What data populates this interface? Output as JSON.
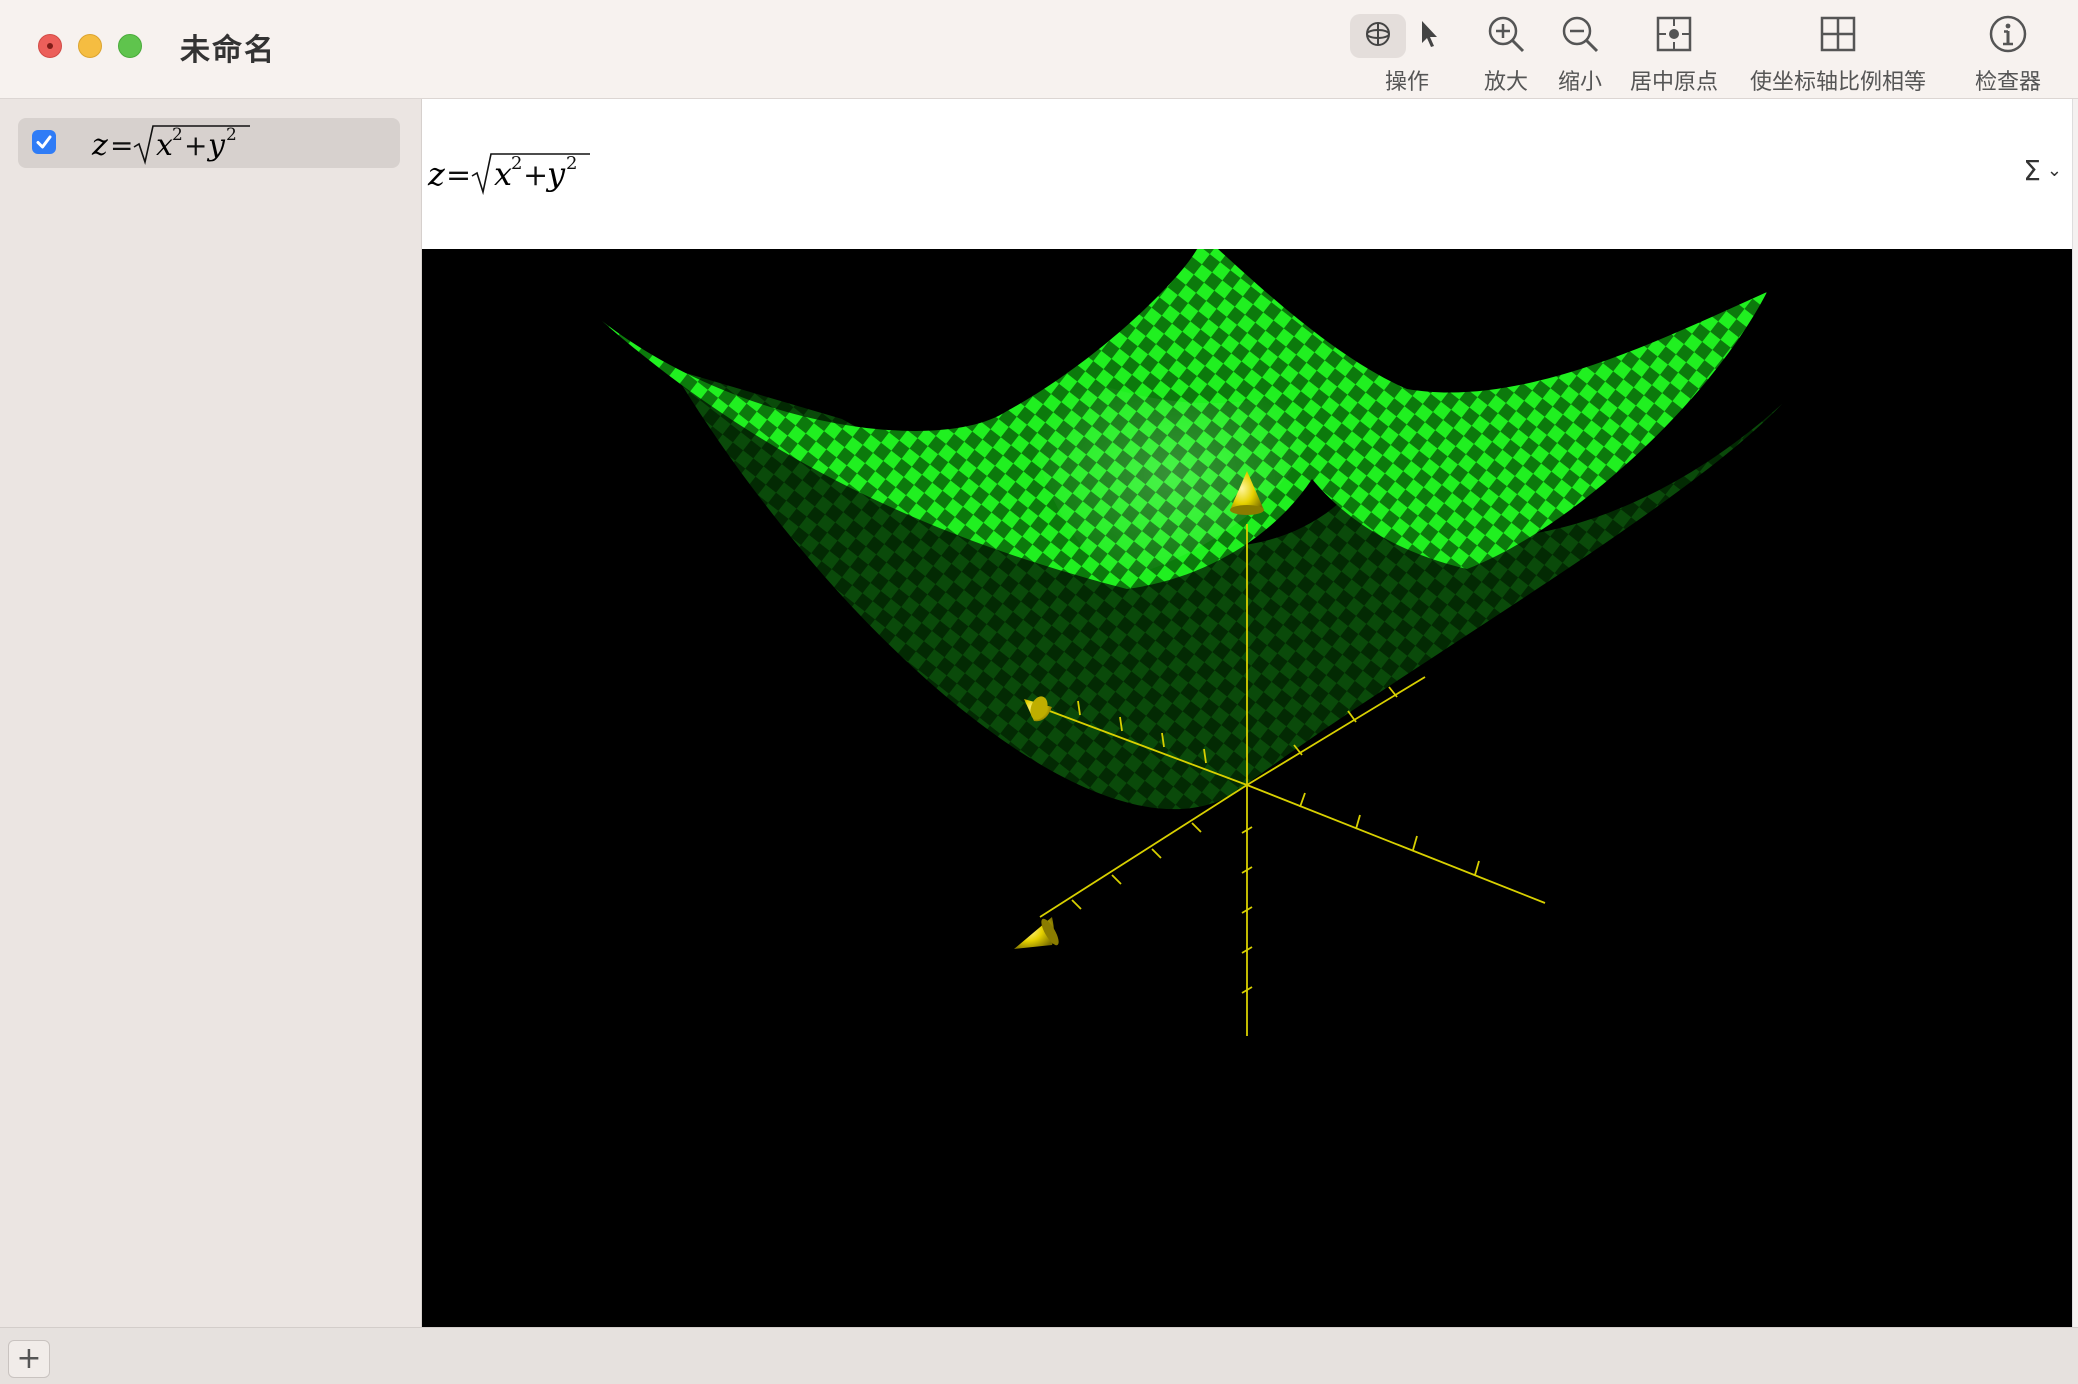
{
  "window": {
    "title": "未命名"
  },
  "toolbar": {
    "mode_label": "操作",
    "mode_orbit_icon": "orbit-icon",
    "mode_select_icon": "pointer-icon",
    "buttons": [
      {
        "label": "放大",
        "icon": "zoom-in-icon"
      },
      {
        "label": "缩小",
        "icon": "zoom-out-icon"
      },
      {
        "label": "居中原点",
        "icon": "center-origin-icon"
      },
      {
        "label": "使坐标轴比例相等",
        "icon": "grid-icon"
      },
      {
        "label": "检查器",
        "icon": "info-icon"
      }
    ]
  },
  "sidebar": {
    "equations": [
      {
        "checked": true,
        "lhs": "z",
        "eq": "=",
        "x": "x",
        "y": "y",
        "plus": "+",
        "exp": "2"
      }
    ]
  },
  "formula_bar": {
    "lhs": "z",
    "eq": "=",
    "x": "x",
    "y": "y",
    "plus": "+",
    "exp": "2",
    "sigma_label": "Σ",
    "sigma_chevron": "⌄"
  },
  "viewport": {
    "background": "#000000",
    "surface_color_light": "#22ff22",
    "surface_color_dark": "#0a6d0a",
    "axis_color": "#d8d000"
  },
  "bottombar": {
    "add_label": "+"
  }
}
